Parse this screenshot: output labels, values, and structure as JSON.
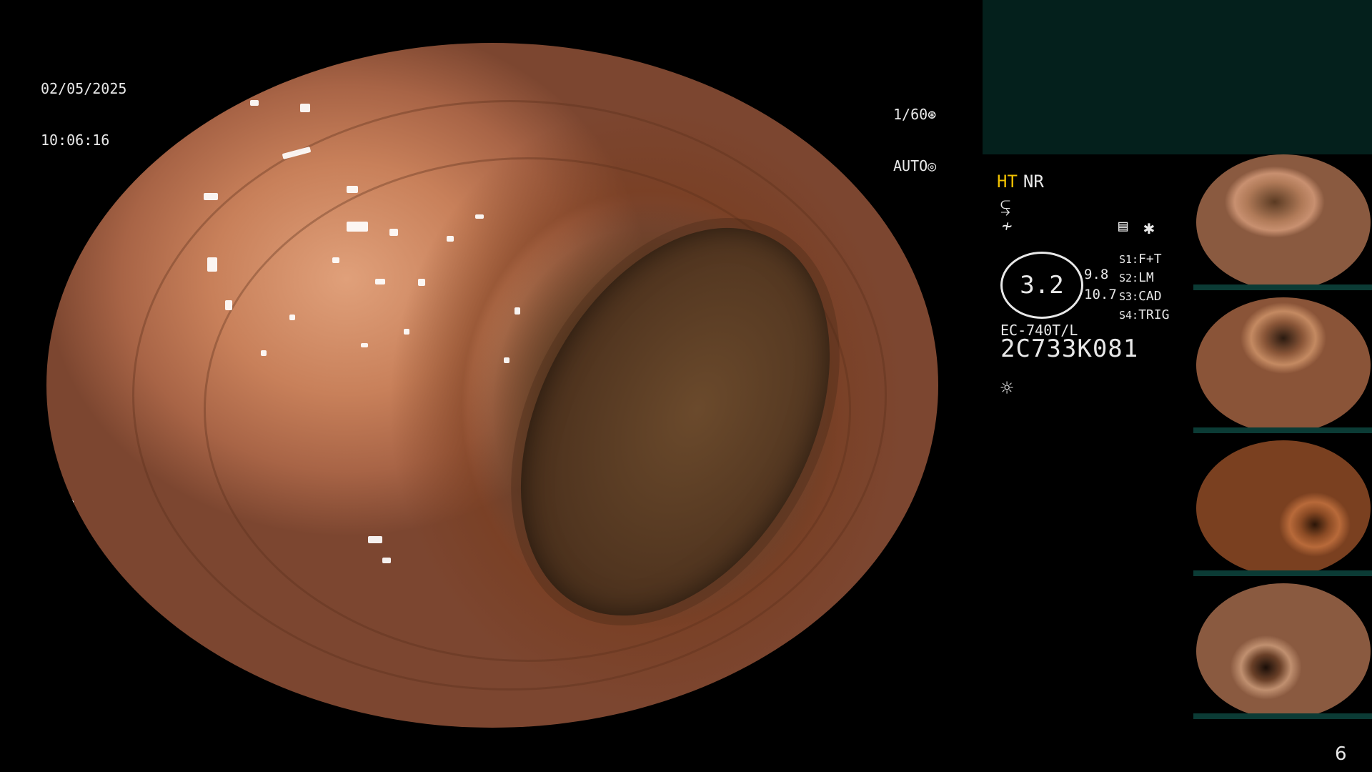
{
  "header": {
    "date": "02/05/2025",
    "time": "10:06:16",
    "shutter": "1/60",
    "exposure_mode": "AUTO"
  },
  "icons": {
    "shutter_icon": "aperture-icon",
    "auto_icon": "auto-iris-icon",
    "setting_icon": "document-icon",
    "asterisk_icon": "asterisk-icon",
    "light_icon": "sun-icon",
    "curve_icon": "tone-curve-icon",
    "contrast_icon": "sharpness-icon"
  },
  "status": {
    "ht_label": "HT",
    "nr_label": "NR",
    "zoom_value": "3.2",
    "values_top": "9.8",
    "values_bottom": "10.7",
    "model": "EC-740T/L",
    "serial": "2C733K081",
    "ht_color": "#f0c000"
  },
  "switches": [
    {
      "key": "S1:",
      "value": "F+T"
    },
    {
      "key": "S2:",
      "value": "LM"
    },
    {
      "key": "S3:",
      "value": "CAD"
    },
    {
      "key": "S4:",
      "value": "TRIG"
    }
  ],
  "thumbnails": [
    {
      "label": "thumbnail-1"
    },
    {
      "label": "thumbnail-2"
    },
    {
      "label": "thumbnail-3"
    },
    {
      "label": "thumbnail-4"
    }
  ],
  "footer": {
    "page_number": "6"
  }
}
